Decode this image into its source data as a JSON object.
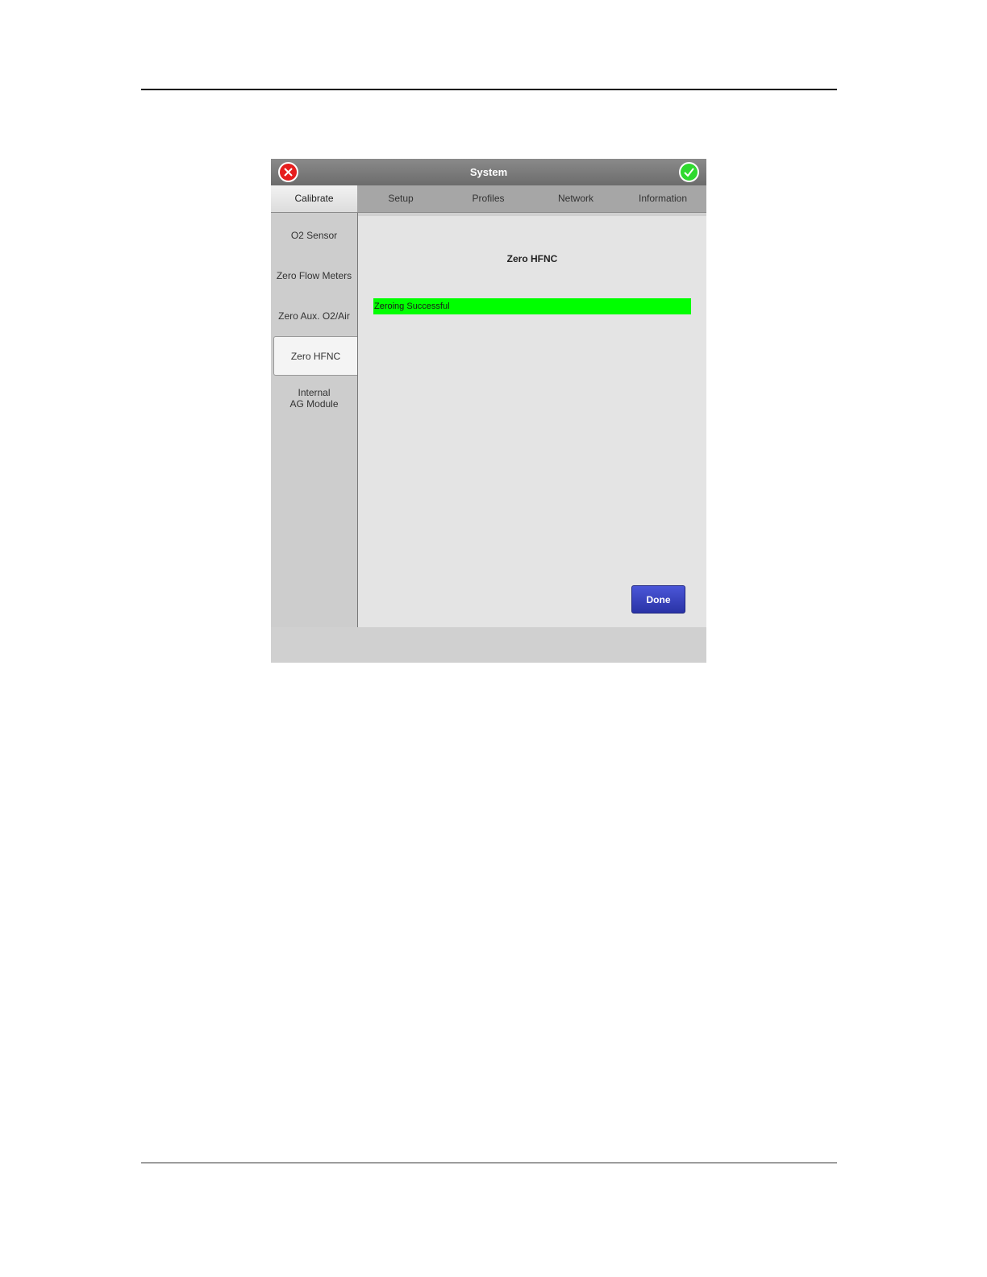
{
  "window": {
    "title": "System",
    "cancel_icon": "close-icon",
    "confirm_icon": "check-icon"
  },
  "tabs": [
    {
      "label": "Calibrate",
      "active": true
    },
    {
      "label": "Setup",
      "active": false
    },
    {
      "label": "Profiles",
      "active": false
    },
    {
      "label": "Network",
      "active": false
    },
    {
      "label": "Information",
      "active": false
    }
  ],
  "sidebar": {
    "items": [
      {
        "label": "O2 Sensor",
        "active": false
      },
      {
        "label": "Zero Flow Meters",
        "active": false
      },
      {
        "label": "Zero Aux. O2/Air",
        "active": false
      },
      {
        "label": "Zero HFNC",
        "active": true
      },
      {
        "label_line1": "Internal",
        "label_line2": "AG Module",
        "active": false
      }
    ]
  },
  "main": {
    "title": "Zero HFNC",
    "status_text": "Zeroing Successful",
    "status_color": "#00ff00",
    "done_label": "Done"
  },
  "colors": {
    "cancel": "#e61e1e",
    "confirm": "#2fd92f",
    "done_button": "#3a44c4"
  }
}
